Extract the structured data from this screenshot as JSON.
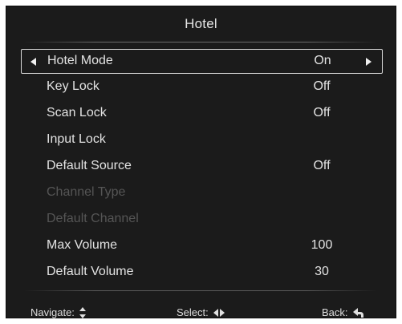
{
  "menu": {
    "title": "Hotel",
    "items": [
      {
        "label": "Hotel Mode",
        "value": "On",
        "selected": true,
        "enabled": true
      },
      {
        "label": "Key Lock",
        "value": "Off",
        "enabled": true
      },
      {
        "label": "Scan Lock",
        "value": "Off",
        "enabled": true
      },
      {
        "label": "Input Lock",
        "value": "",
        "enabled": true
      },
      {
        "label": "Default Source",
        "value": "Off",
        "enabled": true
      },
      {
        "label": "Channel Type",
        "value": "",
        "enabled": false
      },
      {
        "label": "Default Channel",
        "value": "",
        "enabled": false
      },
      {
        "label": "Max Volume",
        "value": "100",
        "enabled": true
      },
      {
        "label": "Default Volume",
        "value": "30",
        "enabled": true
      }
    ]
  },
  "footer": {
    "navigate_label": "Navigate:",
    "navigate_icon": "up-down-arrows-icon",
    "select_label": "Select:",
    "select_icon": "left-right-arrows-icon",
    "back_label": "Back:",
    "back_icon": "back-arrow-icon"
  },
  "colors": {
    "background": "#1b1b1b",
    "text": "#e3e3e3",
    "disabled_text": "#555555",
    "selection_border": "#d9d9d9"
  }
}
